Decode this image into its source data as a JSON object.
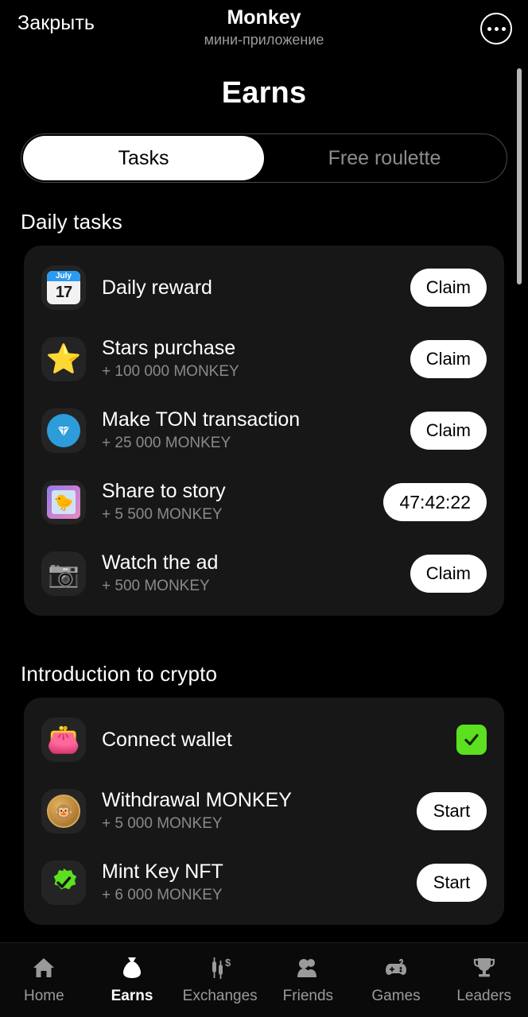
{
  "header": {
    "close_label": "Закрыть",
    "app_title": "Monkey",
    "app_subtitle": "мини-приложение",
    "menu_icon": "ellipsis-icon"
  },
  "page": {
    "title": "Earns"
  },
  "tabs": [
    {
      "label": "Tasks",
      "active": true
    },
    {
      "label": "Free roulette",
      "active": false
    }
  ],
  "sections": [
    {
      "title": "Daily tasks",
      "tasks": [
        {
          "name": "Daily reward",
          "reward": "",
          "action": "Claim",
          "icon": "calendar-icon",
          "state": "claim"
        },
        {
          "name": "Stars purchase",
          "reward": "+ 100 000 MONKEY",
          "action": "Claim",
          "icon": "star-icon",
          "state": "claim"
        },
        {
          "name": "Make TON transaction",
          "reward": "+ 25 000 MONKEY",
          "action": "Claim",
          "icon": "ton-icon",
          "state": "claim"
        },
        {
          "name": "Share to story",
          "reward": "+ 5 500 MONKEY",
          "action": "47:42:22",
          "icon": "story-photo-icon",
          "state": "timer"
        },
        {
          "name": "Watch the ad",
          "reward": "+ 500 MONKEY",
          "action": "Claim",
          "icon": "camera-icon",
          "state": "claim"
        }
      ]
    },
    {
      "title": "Introduction to crypto",
      "tasks": [
        {
          "name": "Connect wallet",
          "reward": "",
          "action": "",
          "icon": "wallet-icon",
          "state": "done"
        },
        {
          "name": "Withdrawal MONKEY",
          "reward": "+ 5 000 MONKEY",
          "action": "Start",
          "icon": "monkey-coin-icon",
          "state": "start"
        },
        {
          "name": "Mint Key NFT",
          "reward": "+ 6 000 MONKEY",
          "action": "Start",
          "icon": "verified-badge-icon",
          "state": "start"
        }
      ]
    }
  ],
  "calendar_icon": {
    "month": "July",
    "day": "17"
  },
  "bottom_nav": [
    {
      "label": "Home",
      "icon": "home-icon",
      "active": false
    },
    {
      "label": "Earns",
      "icon": "money-bag-icon",
      "active": true
    },
    {
      "label": "Exchanges",
      "icon": "candlestick-dollar-icon",
      "active": false
    },
    {
      "label": "Friends",
      "icon": "people-icon",
      "active": false
    },
    {
      "label": "Games",
      "icon": "gamepad-icon",
      "active": false
    },
    {
      "label": "Leaders",
      "icon": "trophy-icon",
      "active": false
    }
  ],
  "colors": {
    "background": "#000000",
    "card": "#171717",
    "accent_green": "#5ce01f",
    "button_bg": "#ffffff",
    "muted_text": "#8a8a8a",
    "ton_blue": "#2d9cdb"
  }
}
